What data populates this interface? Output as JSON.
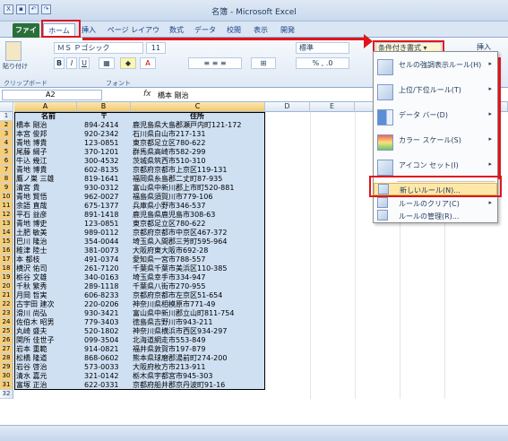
{
  "window": {
    "title": "名簿 - Microsoft Excel"
  },
  "tabs": [
    "ファイル",
    "ホーム",
    "挿入",
    "ページ レイアウト",
    "数式",
    "データ",
    "校閲",
    "表示",
    "開発"
  ],
  "ribbon": {
    "paste_label": "貼り付け",
    "font_name": "ＭＳ Ｐゴシック",
    "font_size": "11",
    "style_label": "標準",
    "insert_label": "挿入",
    "cond_format_label": "条件付き書式",
    "groups": {
      "clipboard": "クリップボード",
      "font": "フォント"
    }
  },
  "formula_bar": {
    "name_box": "A2",
    "fx": "fx",
    "value": "橋本 剛治"
  },
  "columns": [
    "A",
    "B",
    "C",
    "D",
    "E",
    "F"
  ],
  "header_row": {
    "a": "名前",
    "b": "〒",
    "c": "住所"
  },
  "rows": [
    {
      "n": "2",
      "name": "橋本 剛治",
      "zip": "894-2414",
      "addr": "鹿児島県大島郡瀬戸内町121-172"
    },
    {
      "n": "3",
      "name": "本宮 俊邦",
      "zip": "920-2342",
      "addr": "石川県白山市217-131"
    },
    {
      "n": "4",
      "name": "青地 博貴",
      "zip": "123-0851",
      "addr": "東京都足立区780-622"
    },
    {
      "n": "5",
      "name": "尾藤 綱子",
      "zip": "370-1201",
      "addr": "群馬県高崎市582-299"
    },
    {
      "n": "6",
      "name": "牛込 幾江",
      "zip": "300-4532",
      "addr": "茨城県筑西市510-310"
    },
    {
      "n": "7",
      "name": "青地 博貴",
      "zip": "602-8135",
      "addr": "京都府京都市上京区119-131"
    },
    {
      "n": "8",
      "name": "鷹ノ巣 三雄",
      "zip": "819-1641",
      "addr": "福岡県糸島郡二丈町87-935"
    },
    {
      "n": "9",
      "name": "清宮 貴",
      "zip": "930-0312",
      "addr": "富山県中新川郡上市町520-881"
    },
    {
      "n": "10",
      "name": "青地 賢悟",
      "zip": "962-0027",
      "addr": "福島県須賀川市779-106"
    },
    {
      "n": "11",
      "name": "余語 直哉",
      "zip": "675-1377",
      "addr": "兵庫県小野市346-537"
    },
    {
      "n": "12",
      "name": "平石 益彦",
      "zip": "891-1418",
      "addr": "鹿児島県鹿児島市308-63"
    },
    {
      "n": "13",
      "name": "青地 博史",
      "zip": "123-0851",
      "addr": "東京都足立区780-622"
    },
    {
      "n": "14",
      "name": "土肥 敏美",
      "zip": "989-0112",
      "addr": "京都府京都市中京区467-372"
    },
    {
      "n": "15",
      "name": "巴川 隆治",
      "zip": "354-0044",
      "addr": "埼玉県入間郡三芳町595-964"
    },
    {
      "n": "16",
      "name": "稚津 陸士",
      "zip": "381-0073",
      "addr": "大阪府東大阪市692-28"
    },
    {
      "n": "17",
      "name": "本 都枝",
      "zip": "491-0374",
      "addr": "愛知県一宮市788-557"
    },
    {
      "n": "18",
      "name": "横沢 佑司",
      "zip": "261-7120",
      "addr": "千葉県千葉市美浜区110-385"
    },
    {
      "n": "19",
      "name": "栃谷 文雄",
      "zip": "340-0163",
      "addr": "埼玉県幸手市334-947"
    },
    {
      "n": "20",
      "name": "千秋 繁秀",
      "zip": "289-1118",
      "addr": "千葉県八街市270-955"
    },
    {
      "n": "21",
      "name": "月岡 哲実",
      "zip": "606-8233",
      "addr": "京都府京都市左京区51-654"
    },
    {
      "n": "22",
      "name": "古宇田 建次",
      "zip": "220-0206",
      "addr": "神奈川県相模原市771-49"
    },
    {
      "n": "23",
      "name": "滑川 尚弘",
      "zip": "930-3421",
      "addr": "富山県中新川郡立山町811-754"
    },
    {
      "n": "24",
      "name": "佐伯木 昭男",
      "zip": "779-3403",
      "addr": "徳島県吉野川市943-211"
    },
    {
      "n": "25",
      "name": "丸崎 盛夫",
      "zip": "520-1802",
      "addr": "神奈川県横浜市西区934-297"
    },
    {
      "n": "26",
      "name": "関所 佳世子",
      "zip": "099-3504",
      "addr": "北海道網走市553-849"
    },
    {
      "n": "27",
      "name": "岩本 重範",
      "zip": "914-0821",
      "addr": "福井県敦賀市197-879"
    },
    {
      "n": "28",
      "name": "松橋 隆道",
      "zip": "868-0602",
      "addr": "熊本県球磨郡湯前町274-200"
    },
    {
      "n": "29",
      "name": "岩谷 啓治",
      "zip": "573-0033",
      "addr": "大阪府枚方市213-911"
    },
    {
      "n": "30",
      "name": "清水 嘉元",
      "zip": "321-0142",
      "addr": "栃木県宇都宮市945-303"
    },
    {
      "n": "31",
      "name": "富塚 正治",
      "zip": "622-0331",
      "addr": "京都府船井郡京丹波町91-16"
    }
  ],
  "menu": {
    "items": [
      {
        "label": "セルの強調表示ルール(H)",
        "icon": "highlight-rules-icon"
      },
      {
        "label": "上位/下位ルール(T)",
        "icon": "top-bottom-icon"
      },
      {
        "label": "データ バー(D)",
        "icon": "data-bars-icon"
      },
      {
        "label": "カラー スケール(S)",
        "icon": "color-scales-icon"
      },
      {
        "label": "アイコン セット(I)",
        "icon": "icon-sets-icon"
      },
      {
        "label": "新しいルール(N)...",
        "icon": "new-rule-icon"
      },
      {
        "label": "ルールのクリア(C)",
        "icon": "clear-rules-icon"
      },
      {
        "label": "ルールの管理(R)...",
        "icon": "manage-rules-icon"
      }
    ]
  },
  "colors": {
    "highlight_red": "#e0151c",
    "selection_fill": "#cfe0f3",
    "file_tab": "#2a6f3a"
  }
}
